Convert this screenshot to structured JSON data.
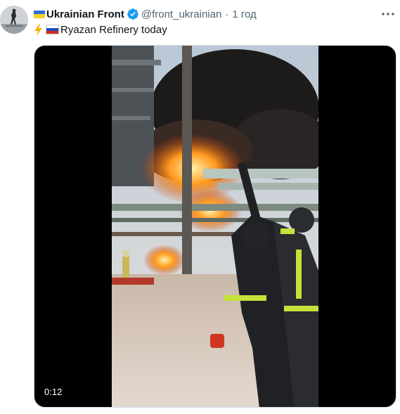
{
  "tweet": {
    "author": {
      "display_name": "Ukrainian Front",
      "handle": "@front_ukrainian",
      "verified": true
    },
    "separator": "·",
    "time": "1 год",
    "text": "Ryazan Refinery today",
    "text_emojis": [
      "lightning-icon",
      "russia-flag-icon"
    ],
    "name_emoji": "ukraine-flag-icon",
    "media": {
      "type": "video",
      "duration": "0:12",
      "description_icons": [
        "fire",
        "refinery",
        "firefighters"
      ]
    }
  },
  "colors": {
    "text_primary": "#0f1419",
    "text_secondary": "#536471",
    "verified_blue": "#1d9bf0",
    "border": "#cfd9de"
  }
}
